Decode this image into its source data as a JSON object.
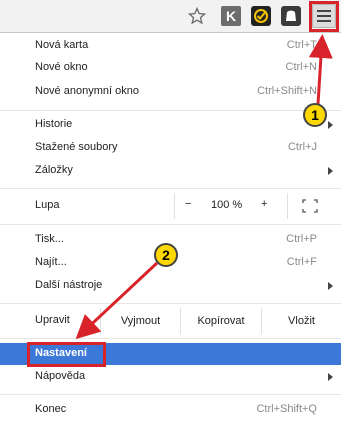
{
  "toolbar": {
    "ext_k_label": "K"
  },
  "menu": {
    "items_top": [
      {
        "label": "Nová karta",
        "shortcut": "Ctrl+T"
      },
      {
        "label": "Nové okno",
        "shortcut": "Ctrl+N"
      },
      {
        "label": "Nové anonymní okno",
        "shortcut": "Ctrl+Shift+N"
      }
    ],
    "items_history": [
      {
        "label": "Historie",
        "submenu": true
      },
      {
        "label": "Stažené soubory",
        "shortcut": "Ctrl+J"
      },
      {
        "label": "Záložky",
        "submenu": true
      }
    ],
    "zoom": {
      "label": "Lupa",
      "minus": "−",
      "value": "100 %",
      "plus": "+"
    },
    "items_tools": [
      {
        "label": "Tisk...",
        "shortcut": "Ctrl+P"
      },
      {
        "label": "Najít...",
        "shortcut": "Ctrl+F"
      },
      {
        "label": "Další nástroje",
        "submenu": true
      }
    ],
    "edit": {
      "label": "Upravit",
      "cut": "Vyjmout",
      "copy": "Kopírovat",
      "paste": "Vložit"
    },
    "items_settings": [
      {
        "label": "Nastavení",
        "highlighted": true
      },
      {
        "label": "Nápověda",
        "submenu": true
      }
    ],
    "exit": {
      "label": "Konec",
      "shortcut": "Ctrl+Shift+Q"
    }
  },
  "annotations": {
    "badge1": "1",
    "badge2": "2",
    "color": "#d8232a",
    "badge_color": "#ffd800"
  },
  "colors": {
    "highlight": "#3c78d8"
  }
}
